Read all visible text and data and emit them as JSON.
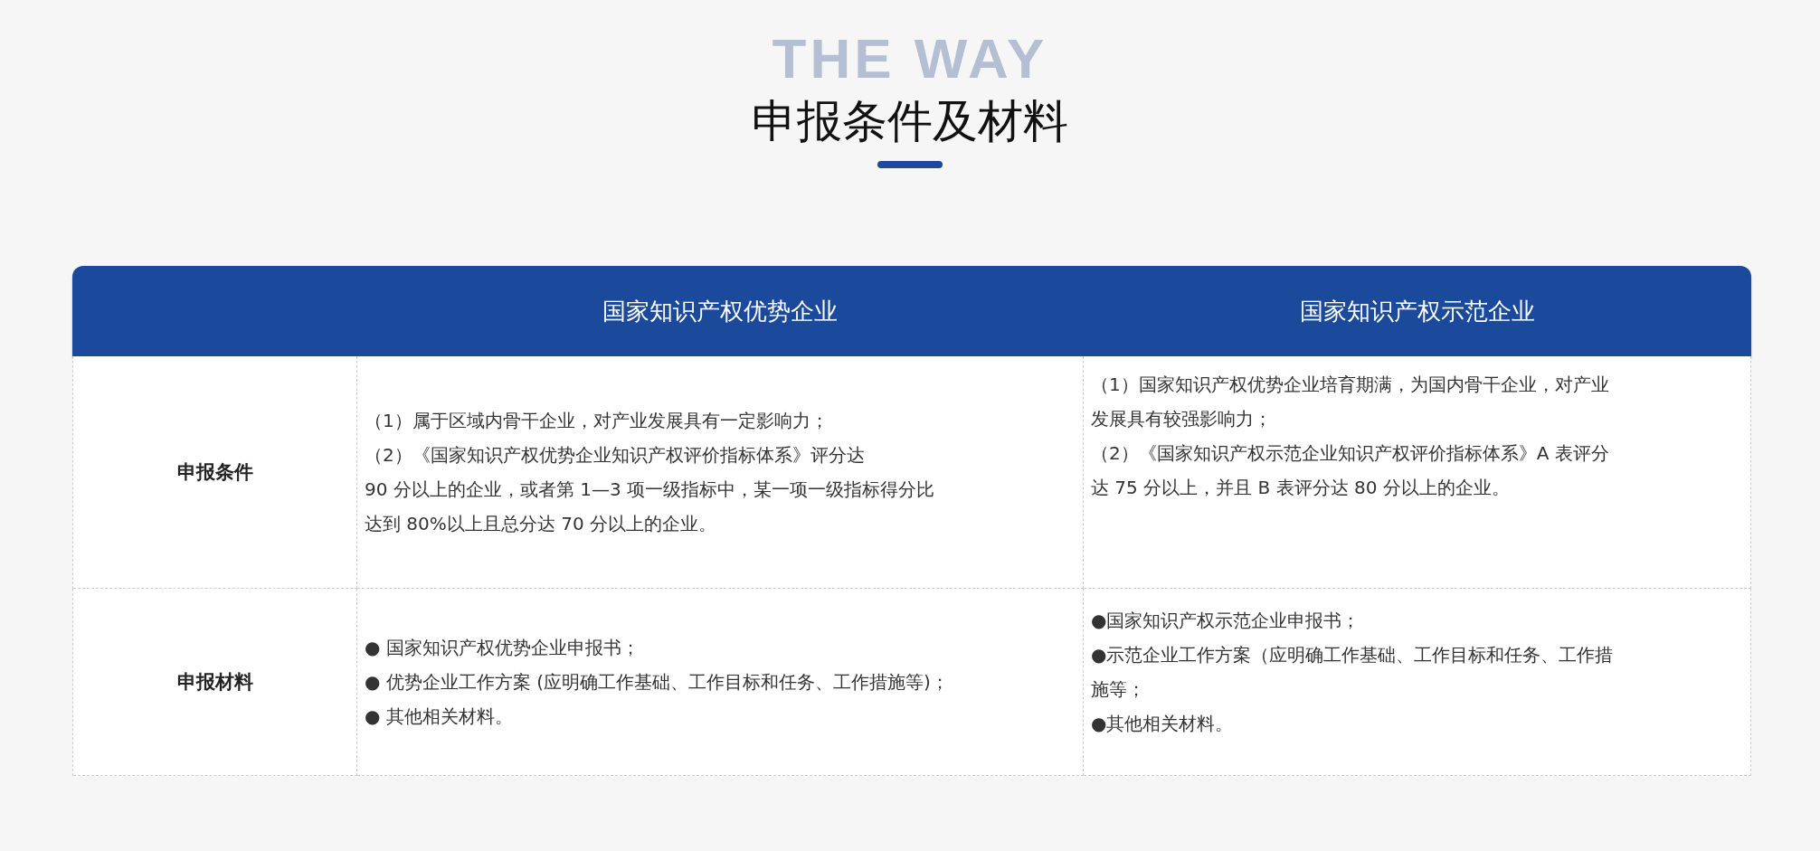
{
  "section": {
    "background_text": "THE WAY",
    "title": "申报条件及材料"
  },
  "table": {
    "columns": [
      "",
      "国家知识产权优势企业",
      "国家知识产权示范企业"
    ],
    "rows": [
      {
        "cells": [
          {
            "lines": [
              "申报条件"
            ]
          },
          {
            "lines": [
              "（1）属于区域内骨干企业，对产业发展具有一定影响力；",
              "（2）《国家知识产权优势企业知识产权评价指标体系》评分达",
              "90 分以上的企业，或者第 1—3 项一级指标中，某一项一级指标得分比",
              "达到 80%以上且总分达 70 分以上的企业。"
            ]
          },
          {
            "lines": [
              "（1）国家知识产权优势企业培育期满，为国内骨干企业，对产业",
              "发展具有较强影响力；",
              "（2）《国家知识产权示范企业知识产权评价指标体系》A 表评分",
              "达 75 分以上，并且 B 表评分达 80 分以上的企业。"
            ]
          }
        ]
      },
      {
        "cells": [
          {
            "lines": [
              "申报材料"
            ]
          },
          {
            "lines": [
              "●  国家知识产权优势企业申报书；",
              "●  优势企业工作方案 (应明确工作基础、工作目标和任务、工作措施等)；",
              "●  其他相关材料。"
            ]
          },
          {
            "lines": [
              "●国家知识产权示范企业申报书；",
              "●示范企业工作方案（应明确工作基础、工作目标和任务、工作措",
              "施等；",
              "●其他相关材料。"
            ]
          }
        ]
      }
    ]
  }
}
